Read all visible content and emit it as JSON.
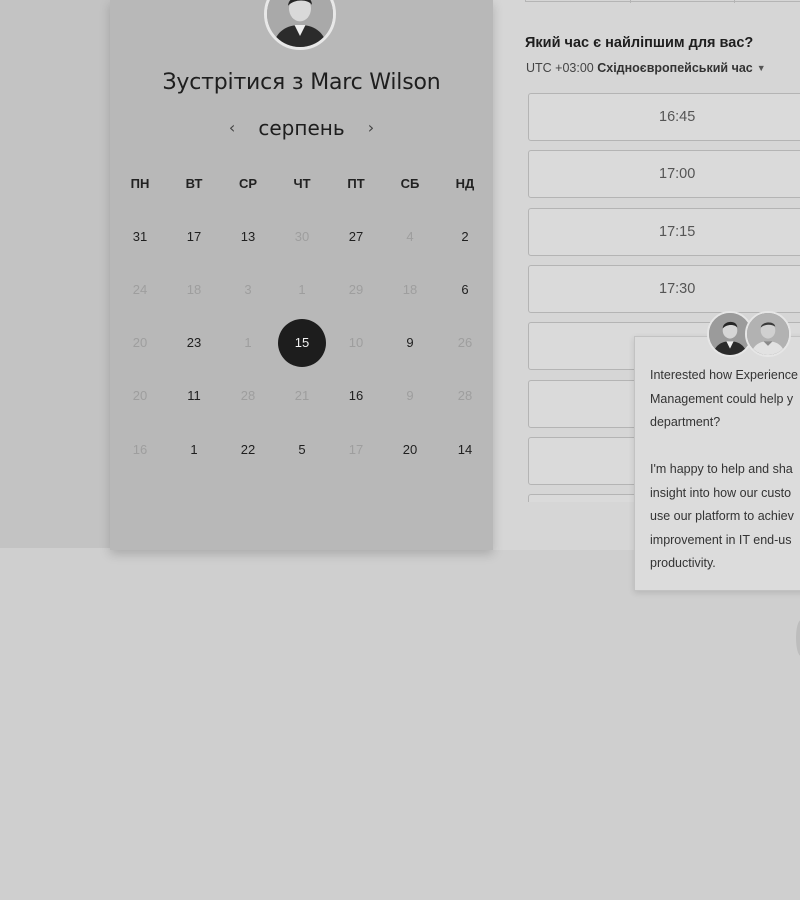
{
  "calendar": {
    "title_prefix": "Зустрітися з",
    "title_name": "Marc Wilson",
    "prev_arrow": "‹",
    "next_arrow": "›",
    "month": "серпень",
    "weekdays": [
      "ПН",
      "ВТ",
      "СР",
      "ЧТ",
      "ПТ",
      "СБ",
      "НД"
    ],
    "weeks": [
      [
        {
          "d": "31",
          "m": false
        },
        {
          "d": "17",
          "m": false
        },
        {
          "d": "13",
          "m": false
        },
        {
          "d": "30",
          "m": true
        },
        {
          "d": "27",
          "m": false
        },
        {
          "d": "4",
          "m": true
        },
        {
          "d": "2",
          "m": false
        }
      ],
      [
        {
          "d": "24",
          "m": true
        },
        {
          "d": "18",
          "m": true
        },
        {
          "d": "3",
          "m": true
        },
        {
          "d": "1",
          "m": true
        },
        {
          "d": "29",
          "m": true
        },
        {
          "d": "18",
          "m": true
        },
        {
          "d": "6",
          "m": false
        }
      ],
      [
        {
          "d": "20",
          "m": true
        },
        {
          "d": "23",
          "m": false
        },
        {
          "d": "1",
          "m": true
        },
        {
          "d": "15",
          "m": false,
          "sel": true
        },
        {
          "d": "10",
          "m": true
        },
        {
          "d": "9",
          "m": false
        },
        {
          "d": "26",
          "m": true
        }
      ],
      [
        {
          "d": "20",
          "m": true
        },
        {
          "d": "11",
          "m": false
        },
        {
          "d": "28",
          "m": true
        },
        {
          "d": "21",
          "m": true
        },
        {
          "d": "16",
          "m": false
        },
        {
          "d": "9",
          "m": true
        },
        {
          "d": "28",
          "m": true
        }
      ],
      [
        {
          "d": "16",
          "m": true
        },
        {
          "d": "1",
          "m": false
        },
        {
          "d": "22",
          "m": false
        },
        {
          "d": "5",
          "m": false
        },
        {
          "d": "17",
          "m": true
        },
        {
          "d": "20",
          "m": false
        },
        {
          "d": "14",
          "m": false
        }
      ]
    ]
  },
  "times": {
    "heading": "Який час є найліпшим для вас?",
    "tz_offset": "UTC +03:00",
    "tz_name": "Східноєвропейський час",
    "slots": [
      "16:45",
      "17:00",
      "17:15",
      "17:30",
      "",
      "",
      "",
      ""
    ]
  },
  "chat": {
    "lines": [
      "Interested how Experience",
      "Management could help y",
      "department?",
      "",
      "I'm happy to help and sha",
      "insight into how our custo",
      "use our platform to achiev",
      "improvement in IT end-us",
      "productivity."
    ]
  }
}
